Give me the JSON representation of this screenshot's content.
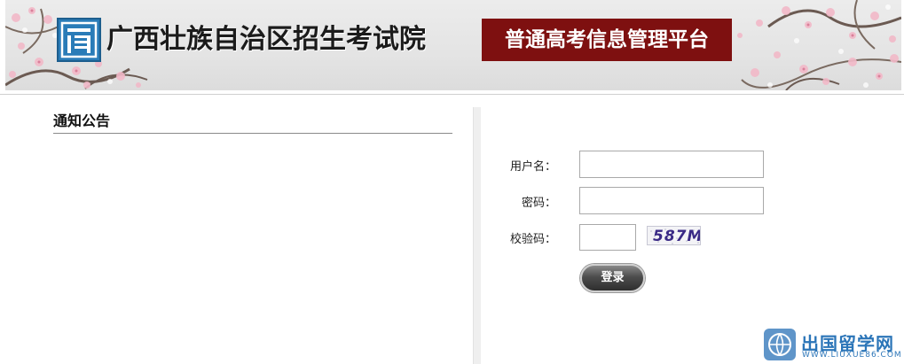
{
  "header": {
    "org_title": "广西壮族自治区招生考试院",
    "platform_title": "普通高考信息管理平台",
    "logo_icon": "exam-institute-logo-icon",
    "platform_color": "#7e1010"
  },
  "notice": {
    "title": "通知公告"
  },
  "login": {
    "username_label": "用户名：",
    "password_label": "密码：",
    "captcha_label": "校验码：",
    "username_value": "",
    "password_value": "",
    "captcha_value": "",
    "captcha_text": "587M",
    "submit_label": "登录"
  },
  "watermark": {
    "title": "出国留学网",
    "url": "WWW.LIUXUE86.COM",
    "icon": "globe-logo-icon",
    "color": "#2b75b8"
  }
}
